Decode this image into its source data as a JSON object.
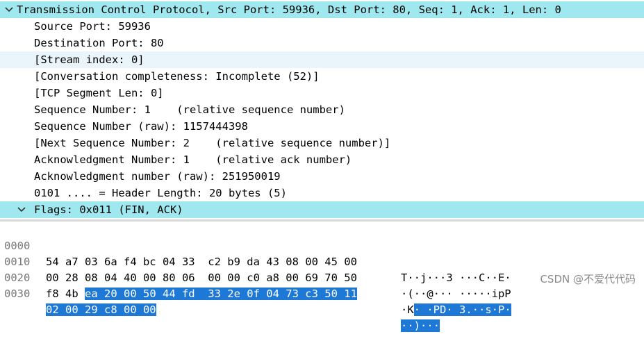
{
  "tree": {
    "header": "Transmission Control Protocol, Src Port: 59936, Dst Port: 80, Seq: 1, Ack: 1, Len: 0",
    "fields": [
      "Source Port: 59936",
      "Destination Port: 80",
      "[Stream index: 0]",
      "[Conversation completeness: Incomplete (52)]",
      "[TCP Segment Len: 0]",
      "Sequence Number: 1    (relative sequence number)",
      "Sequence Number (raw): 1157444398",
      "[Next Sequence Number: 2    (relative sequence number)]",
      "Acknowledgment Number: 1    (relative ack number)",
      "Acknowledgment number (raw): 251950019",
      "0101 .... = Header Length: 20 bytes (5)"
    ],
    "flags": "Flags: 0x011 (FIN, ACK)"
  },
  "hex_rows": [
    {
      "offset": "0000",
      "bytes_plain": "54 a7 03 6a f4 bc 04 33  c2 b9 da 43 08 00 45 00",
      "bytes_hl": "",
      "ascii_plain": "T··j···3 ···C··E·",
      "ascii_hl": ""
    },
    {
      "offset": "0010",
      "bytes_plain": "00 28 08 04 40 00 80 06  00 00 c0 a8 00 69 70 50",
      "bytes_hl": "",
      "ascii_plain": "·(··@··· ·····ipP",
      "ascii_hl": ""
    },
    {
      "offset": "0020",
      "bytes_plain": "f8 4b ",
      "bytes_hl": "ea 20 00 50 44 fd  33 2e 0f 04 73 c3 50 11",
      "ascii_plain": "·K",
      "ascii_hl": "· ·PD· 3.··s·P·"
    },
    {
      "offset": "0030",
      "bytes_plain": "",
      "bytes_hl": "02 00 29 c8 00 00",
      "ascii_plain": "",
      "ascii_hl": "··)···"
    }
  ],
  "watermark": "CSDN @不爱代代码",
  "icons": {
    "expanded": "chevron-down-icon"
  },
  "colors": {
    "header_bg": "#a0e8f0",
    "selection_bg": "#eaf5fb",
    "byte_highlight": "#1e78d6"
  }
}
